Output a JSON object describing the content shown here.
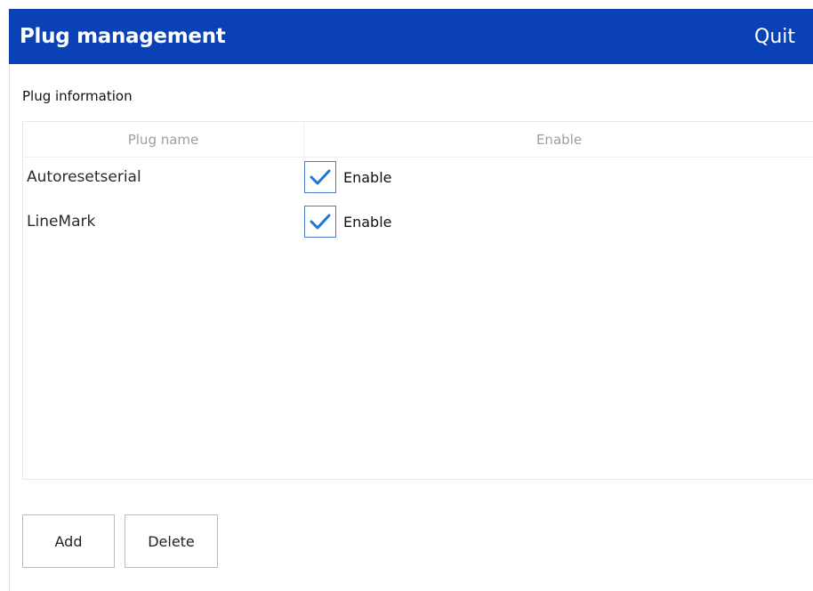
{
  "header": {
    "title": "Plug management",
    "quit_label": "Quit"
  },
  "section": {
    "label": "Plug information"
  },
  "table": {
    "columns": [
      "Plug  name",
      "Enable"
    ],
    "rows": [
      {
        "name": "Autoresetserial",
        "enabled": true,
        "enable_label": "Enable"
      },
      {
        "name": "LineMark",
        "enabled": true,
        "enable_label": "Enable"
      }
    ]
  },
  "buttons": {
    "add_label": "Add",
    "delete_label": "Delete"
  },
  "colors": {
    "titlebar": "#0a42b5",
    "checkmark": "#1f78d8",
    "checkbox_border": "#4a78c8"
  },
  "icons": {
    "checkbox_checked": "checkmark-icon"
  }
}
